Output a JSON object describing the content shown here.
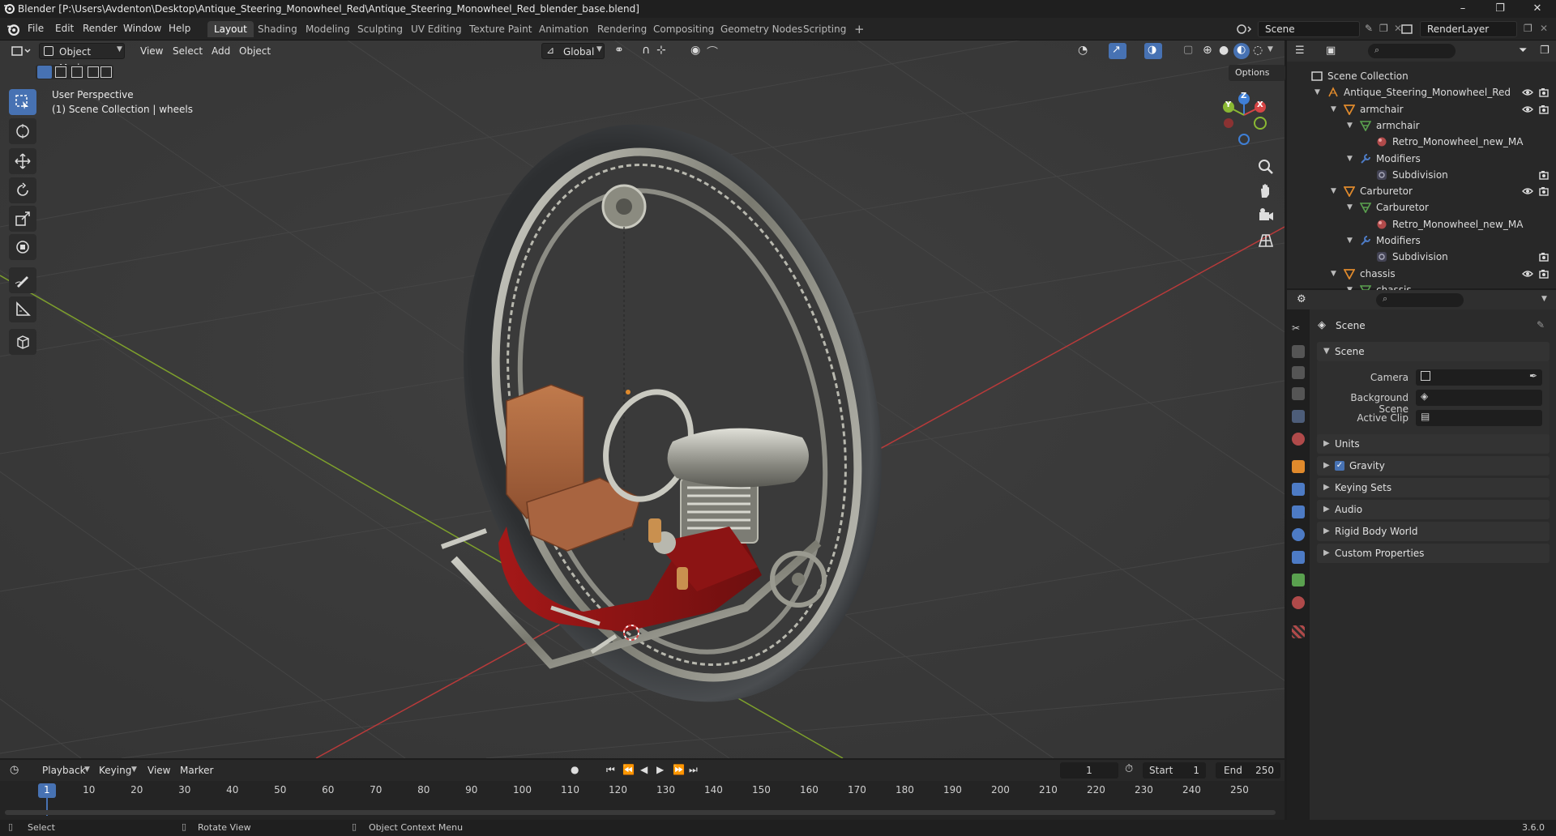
{
  "window": {
    "title": "Blender [P:\\Users\\Avdenton\\Desktop\\Antique_Steering_Monowheel_Red\\Antique_Steering_Monowheel_Red_blender_base.blend]",
    "minimize": "–",
    "maximize": "❐",
    "close": "✕"
  },
  "menu": {
    "file": "File",
    "edit": "Edit",
    "render": "Render",
    "window": "Window",
    "help": "Help"
  },
  "workspaces": [
    "Layout",
    "Shading",
    "Modeling",
    "Sculpting",
    "UV Editing",
    "Texture Paint",
    "Animation",
    "Rendering",
    "Compositing",
    "Geometry Nodes",
    "Scripting"
  ],
  "add_workspace": "+",
  "scene_field": "Scene",
  "renderlayer_field": "RenderLayer",
  "viewport_header": {
    "mode": "Object Mode",
    "view": "View",
    "select": "Select",
    "add": "Add",
    "object": "Object",
    "orientation": "Global",
    "options": "Options"
  },
  "viewport_overlay": {
    "perspective": "User Perspective",
    "collection": "(1) Scene Collection | wheels"
  },
  "gizmo": {
    "x": "X",
    "y": "Y",
    "z": "Z"
  },
  "outliner": {
    "search_placeholder": "",
    "rows": [
      {
        "label": "Scene Collection",
        "indent": 0,
        "icon": "collection"
      },
      {
        "label": "Antique_Steering_Monowheel_Red",
        "indent": 1,
        "icon": "empty"
      },
      {
        "label": "armchair",
        "indent": 2,
        "icon": "object"
      },
      {
        "label": "armchair",
        "indent": 3,
        "icon": "mesh"
      },
      {
        "label": "Retro_Monowheel_new_MA",
        "indent": 4,
        "icon": "material"
      },
      {
        "label": "Modifiers",
        "indent": 3,
        "icon": "wrench"
      },
      {
        "label": "Subdivision",
        "indent": 4,
        "icon": "modifier"
      },
      {
        "label": "Carburetor",
        "indent": 2,
        "icon": "object"
      },
      {
        "label": "Carburetor",
        "indent": 3,
        "icon": "mesh"
      },
      {
        "label": "Retro_Monowheel_new_MA",
        "indent": 4,
        "icon": "material"
      },
      {
        "label": "Modifiers",
        "indent": 3,
        "icon": "wrench"
      },
      {
        "label": "Subdivision",
        "indent": 4,
        "icon": "modifier"
      },
      {
        "label": "chassis",
        "indent": 2,
        "icon": "object"
      },
      {
        "label": "chassis",
        "indent": 3,
        "icon": "mesh"
      }
    ]
  },
  "properties": {
    "context": "Scene",
    "panel_scene": "Scene",
    "camera_label": "Camera",
    "background_scene_label": "Background Scene",
    "active_clip_label": "Active Clip",
    "panels": [
      "Units",
      "Gravity",
      "Keying Sets",
      "Audio",
      "Rigid Body World",
      "Custom Properties"
    ],
    "gravity_checked": true
  },
  "timeline": {
    "playback": "Playback",
    "keying": "Keying",
    "view": "View",
    "marker": "Marker",
    "current_frame": "1",
    "start_label": "Start",
    "start": "1",
    "end_label": "End",
    "end": "250",
    "ticks": [
      "1",
      "10",
      "20",
      "30",
      "40",
      "50",
      "60",
      "70",
      "80",
      "90",
      "100",
      "110",
      "120",
      "130",
      "140",
      "150",
      "160",
      "170",
      "180",
      "190",
      "200",
      "210",
      "220",
      "230",
      "240",
      "250"
    ]
  },
  "statusbar": {
    "select": "Select",
    "rotate": "Rotate View",
    "context_menu": "Object Context Menu",
    "version": "3.6.0"
  },
  "colors": {
    "accent": "#4772b3",
    "x_axis": "#d64545",
    "y_axis": "#8ab833",
    "z_axis": "#3f7fd6",
    "object_orange": "#e08a2c"
  }
}
